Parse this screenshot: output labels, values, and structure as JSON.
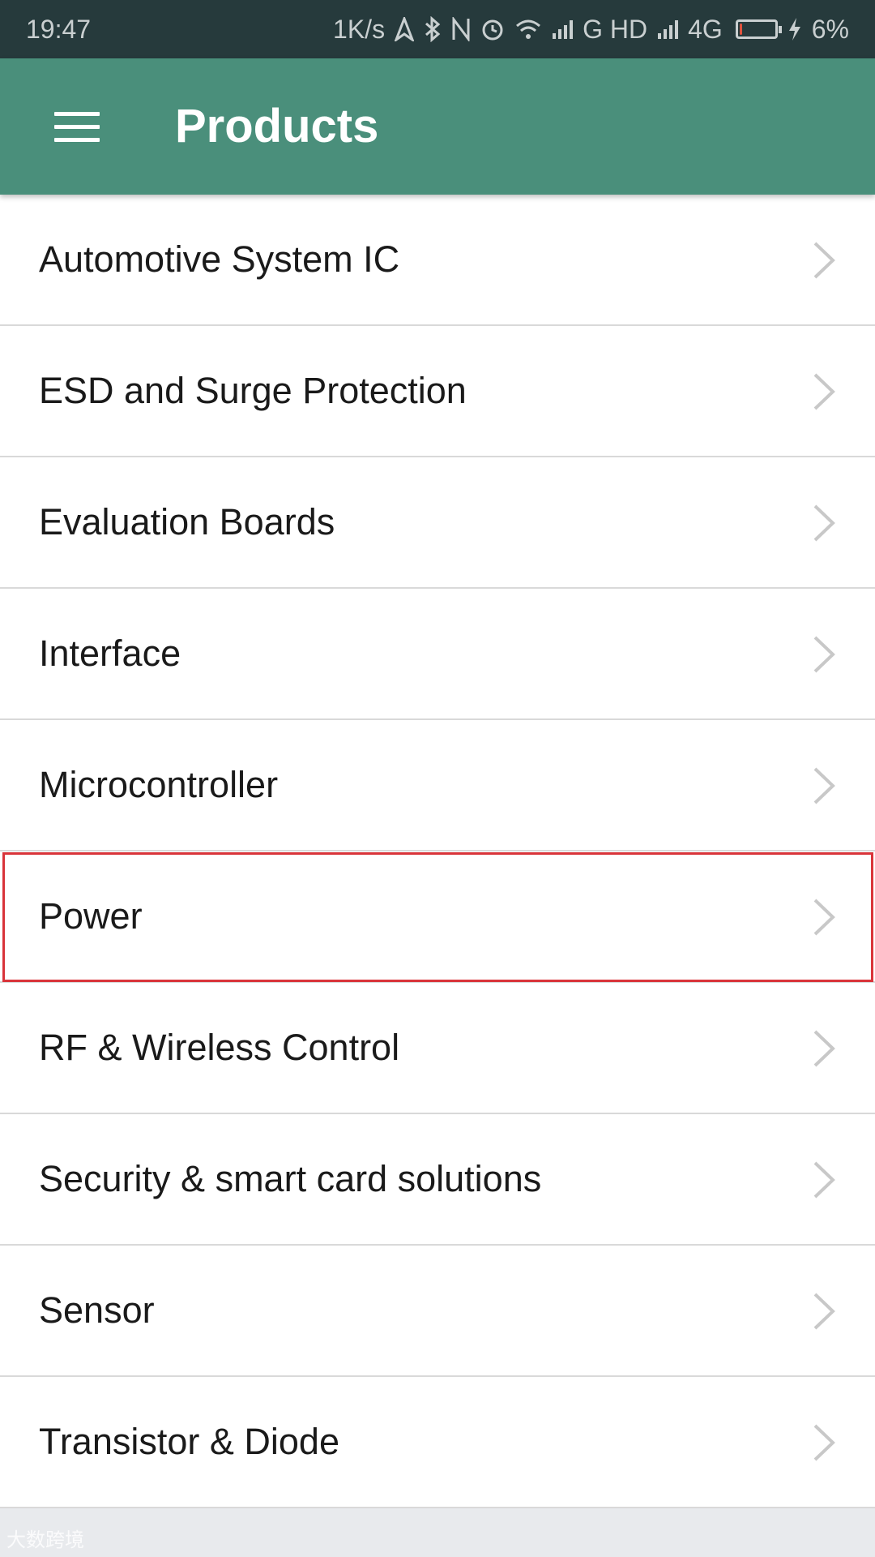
{
  "status_bar": {
    "time": "19:47",
    "net_speed": "1K/s",
    "signal_1": "G HD",
    "signal_2": "4G",
    "battery_percent": "6%",
    "battery_level": 0.06,
    "icons": [
      "location-icon",
      "bluetooth-icon",
      "nfc-icon",
      "alarm-icon",
      "wifi-icon",
      "signal-icon",
      "charging-icon"
    ]
  },
  "app_bar": {
    "title": "Products",
    "menu_icon": "hamburger-menu-icon",
    "background": "#4a8f7b"
  },
  "products": {
    "items": [
      {
        "label": "Automotive System IC"
      },
      {
        "label": "ESD and Surge Protection"
      },
      {
        "label": "Evaluation Boards"
      },
      {
        "label": "Interface"
      },
      {
        "label": "Microcontroller"
      },
      {
        "label": "Power",
        "highlighted": true
      },
      {
        "label": "RF & Wireless Control"
      },
      {
        "label": "Security & smart card solutions"
      },
      {
        "label": "Sensor"
      },
      {
        "label": "Transistor & Diode"
      }
    ],
    "chevron_icon": "chevron-right-icon",
    "highlight_color": "#d9343a"
  },
  "watermark": "大数跨境"
}
